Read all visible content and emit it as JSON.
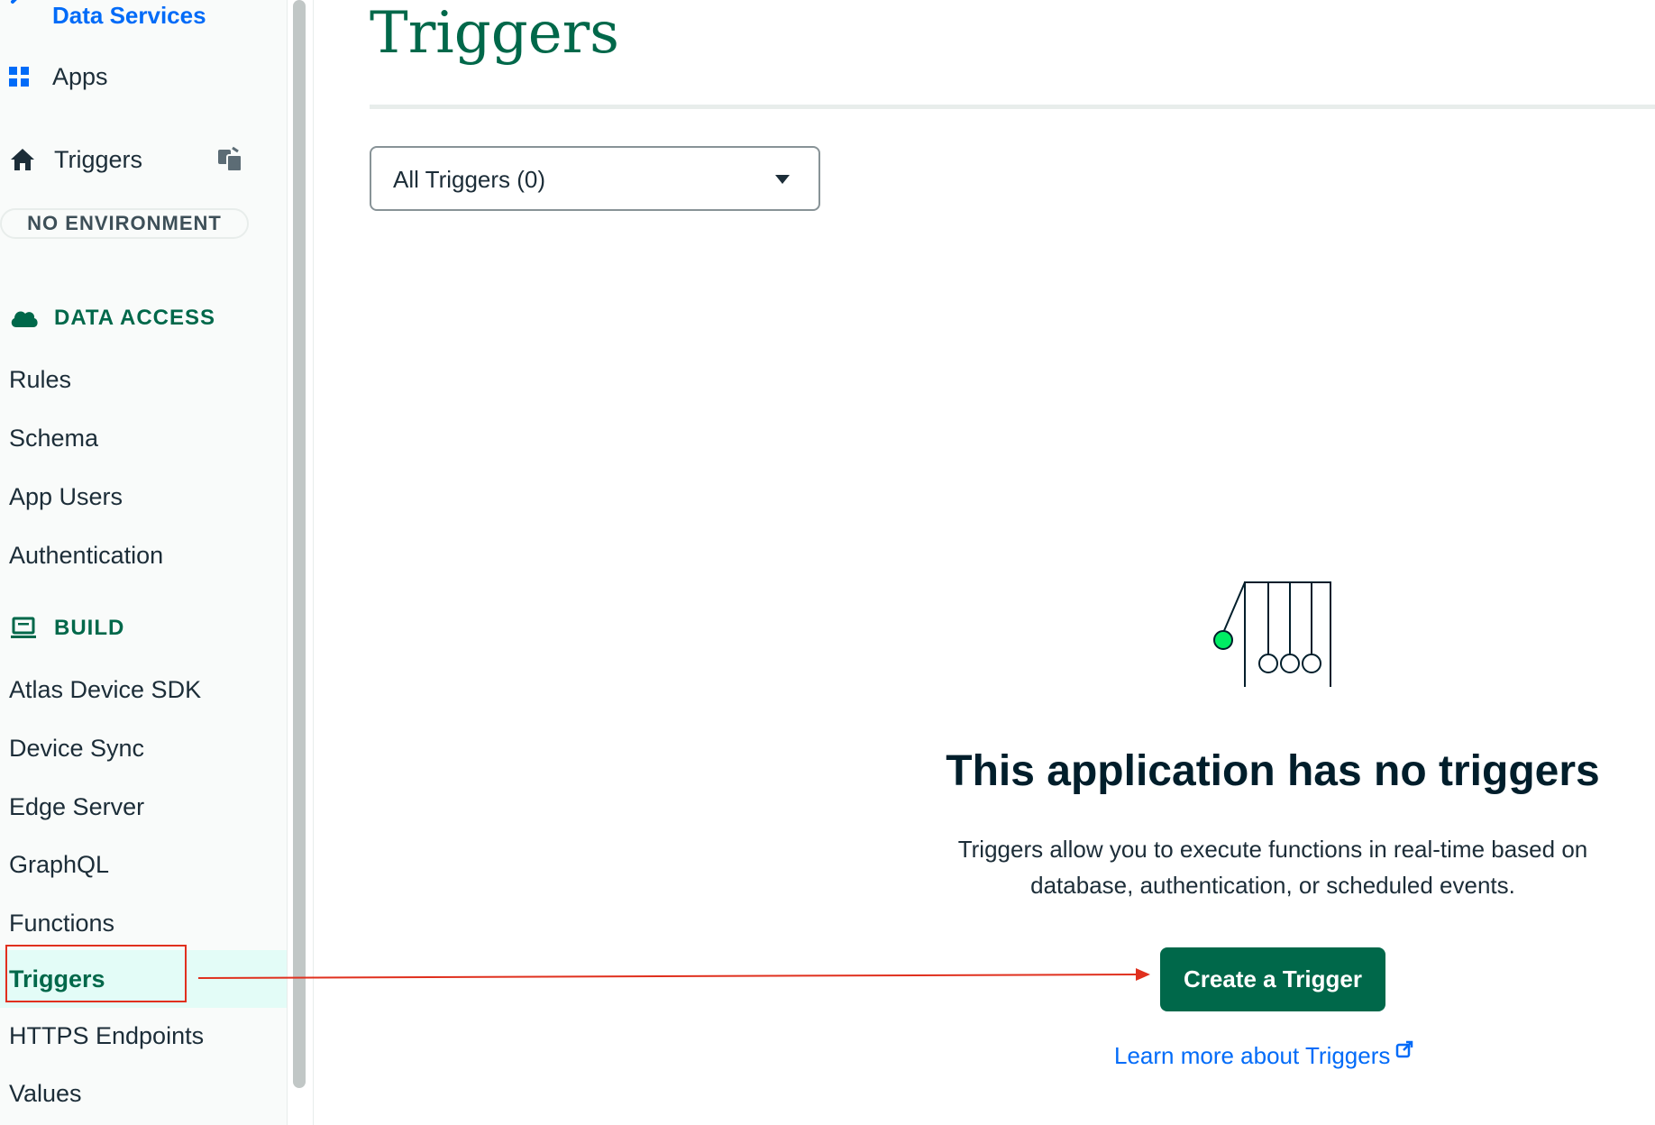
{
  "sidebar": {
    "back_link": "Data Services",
    "apps_label": "Apps",
    "home_label": "Triggers",
    "environment_badge": "NO ENVIRONMENT",
    "sections": {
      "data_access": {
        "label": "DATA ACCESS",
        "items": [
          "Rules",
          "Schema",
          "App Users",
          "Authentication"
        ]
      },
      "build": {
        "label": "BUILD",
        "items": [
          "Atlas Device SDK",
          "Device Sync",
          "Edge Server",
          "GraphQL",
          "Functions",
          "Triggers",
          "HTTPS Endpoints",
          "Values"
        ]
      }
    },
    "active_item": "Triggers"
  },
  "main": {
    "title": "Triggers",
    "filter": {
      "selected": "All Triggers (0)"
    },
    "empty_state": {
      "title": "This application has no triggers",
      "description_line1": "Triggers allow you to execute functions in real-time based on",
      "description_line2": "database, authentication, or scheduled events.",
      "create_button": "Create a Trigger",
      "learn_more": "Learn more about Triggers"
    }
  },
  "colors": {
    "brand_green": "#00684a",
    "link_blue": "#016bf8",
    "annotation_red": "#e0301e",
    "active_bg": "#e3fcf7",
    "pendulum_ball": "#00ed64"
  },
  "icons": [
    "chevron-left-icon",
    "apps-grid-icon",
    "home-icon",
    "copy-icon",
    "cloud-icon",
    "laptop-icon",
    "external-link-icon",
    "newtons-cradle-illustration"
  ]
}
